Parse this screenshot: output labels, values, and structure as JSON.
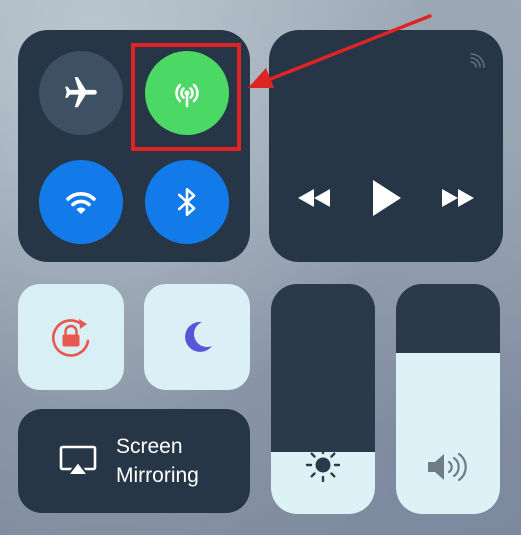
{
  "connectivity": {
    "airplane_mode": {
      "icon": "airplane-icon",
      "active": false
    },
    "cellular_data": {
      "icon": "cellular-antenna-icon",
      "active": true,
      "color": "#4cd864"
    },
    "wifi": {
      "icon": "wifi-icon",
      "active": true,
      "color": "#127be9"
    },
    "bluetooth": {
      "icon": "bluetooth-icon",
      "active": true,
      "color": "#127be9"
    }
  },
  "media": {
    "airplay_icon": "airplay-audio-icon",
    "controls": [
      "rewind-icon",
      "play-icon",
      "fast-forward-icon"
    ]
  },
  "orientation_lock": {
    "icon": "rotation-lock-icon",
    "active": true,
    "color": "#e8564e"
  },
  "do_not_disturb": {
    "icon": "moon-icon",
    "active": true,
    "color": "#5856d6"
  },
  "screen_mirroring": {
    "line1": "Screen",
    "line2": "Mirroring",
    "icon": "airplay-screen-icon"
  },
  "brightness": {
    "icon": "sun-icon",
    "level": 0.27
  },
  "volume": {
    "icon": "speaker-icon",
    "level": 0.7
  },
  "annotation": {
    "color": "#e02424",
    "target": "cellular_data"
  }
}
